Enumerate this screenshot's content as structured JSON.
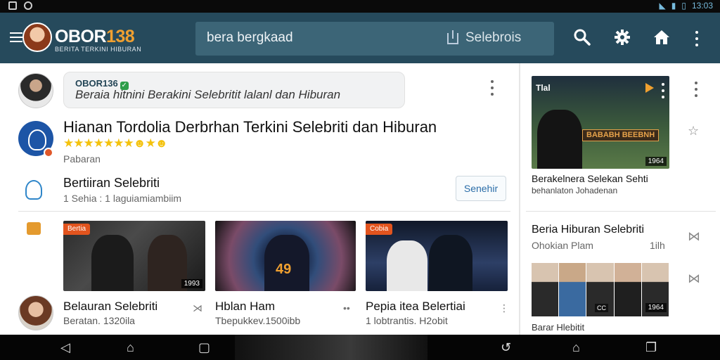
{
  "app": {
    "brand_main": "OBOR",
    "brand_num": "138",
    "brand_sub": "BERITA TERKINI HIBURAN",
    "search_text": "bera bergkaad",
    "search_category": "Selebrois"
  },
  "post": {
    "handle": "OBOR136",
    "text": "Beraia hitnini Berakini Selebritit lalanl dan Hiburan"
  },
  "channel": {
    "title": "Hianan Tordolia Derbrhan Terkini Selebriti dan Hiburan",
    "stars": "★★★★★★★☻★☻",
    "subtitle": "Pabaran"
  },
  "category": {
    "title": "Bertiiran Selebriti",
    "subtitle": "1 Sehia : 1 laguiamiambiim",
    "button": "Senehir"
  },
  "videos": [
    {
      "tag": "Bertia",
      "duration": "1993",
      "title": "Belauran Selebriti",
      "meta": "Beratan. 1320ila",
      "action": "⋊"
    },
    {
      "tag": "",
      "duration": "",
      "title": "Hblan Ham",
      "meta": "Tbepukkev.1500ibb",
      "action": "••"
    },
    {
      "tag": "Cobia",
      "duration": "",
      "title": "Pepia itea Belertiai",
      "meta": "1 lobtrantis. H2obit",
      "action": "⋮"
    }
  ],
  "side": {
    "thumb_label": "Tlal",
    "thumb_overlay": "BABABH BEEBNH",
    "thumb_duration": "1964",
    "video_title": "Berakelnera Selekan Sehti",
    "video_sub": "behanlaton Johadenan",
    "section_title": "Beria Hiburan Selebriti",
    "section_sub": "Ohokian Plam",
    "section_count": "1ilh",
    "thumb2_duration": "1964",
    "thumb2_cc": "CC",
    "bottom_text": "Barar Hlebitit"
  },
  "status": {
    "time": "13:03"
  }
}
